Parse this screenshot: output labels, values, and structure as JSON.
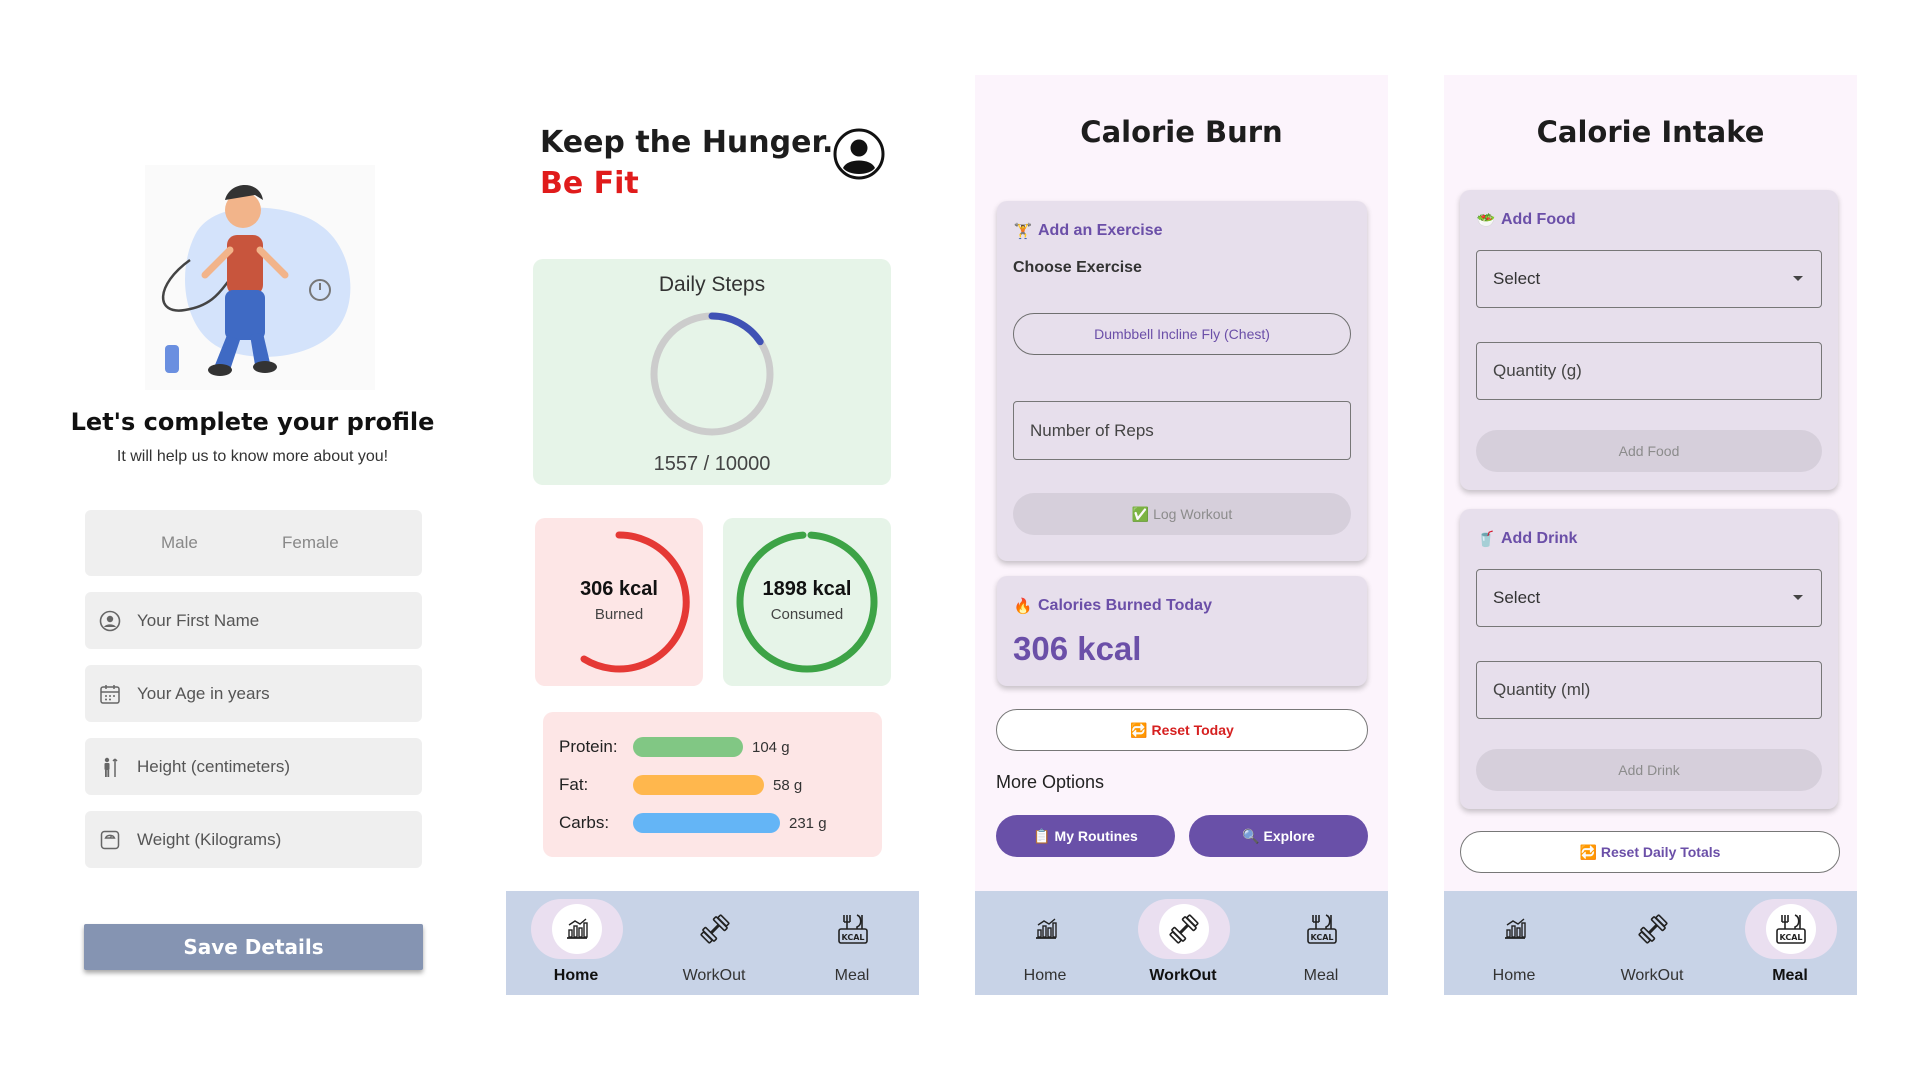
{
  "profile": {
    "title": "Let's complete your profile",
    "subtitle": "It will help us to know more about you!",
    "gender_options": [
      "Male",
      "Female"
    ],
    "fields": [
      {
        "placeholder": "Your First Name",
        "icon": "user-circle-icon"
      },
      {
        "placeholder": "Your Age in years",
        "icon": "calendar-icon"
      },
      {
        "placeholder": "Height (centimeters)",
        "icon": "height-icon"
      },
      {
        "placeholder": "Weight (Kilograms)",
        "icon": "scale-icon"
      }
    ],
    "save_label": "Save Details",
    "button_color": "#8594b2"
  },
  "home": {
    "title_line1": "Keep the Hunger.",
    "title_line2": "Be Fit",
    "accent_color": "#e01b1b",
    "steps": {
      "title": "Daily Steps",
      "value_text": "1557 / 10000",
      "current": 1557,
      "goal": 10000
    },
    "burned": {
      "value": "306 kcal",
      "label": "Burned",
      "color": "#e53935"
    },
    "consumed": {
      "value": "1898 kcal",
      "label": "Consumed",
      "color": "#3da346"
    },
    "macros": [
      {
        "label": "Protein:",
        "value": "104 g",
        "color": "#81c784"
      },
      {
        "label": "Fat:",
        "value": "58 g",
        "color": "#ffb74d"
      },
      {
        "label": "Carbs:",
        "value": "231 g",
        "color": "#64b5f6"
      }
    ]
  },
  "nav": {
    "items": [
      "Home",
      "WorkOut",
      "Meal"
    ]
  },
  "burn": {
    "title": "Calorie Burn",
    "add_exercise_title": "Add an Exercise",
    "choose_label": "Choose Exercise",
    "exercise_selected": "Dumbbell Incline Fly (Chest)",
    "reps_placeholder": "Number of Reps",
    "log_label": "✅ Log Workout",
    "burned_today_title": "Calories Burned Today",
    "burned_today_value": "306 kcal",
    "reset_label": "🔁 Reset Today",
    "more_options": "More Options",
    "routines_label": "📋 My Routines",
    "explore_label": "🔍 Explore",
    "accent_color": "#6b4fa8"
  },
  "intake": {
    "title": "Calorie Intake",
    "food_title": "Add Food",
    "food_select": "Select",
    "food_qty_placeholder": "Quantity (g)",
    "food_btn": "Add Food",
    "drink_title": "Add Drink",
    "drink_select": "Select",
    "drink_qty_placeholder": "Quantity (ml)",
    "drink_btn": "Add Drink",
    "reset_label": "🔁 Reset Daily Totals"
  }
}
